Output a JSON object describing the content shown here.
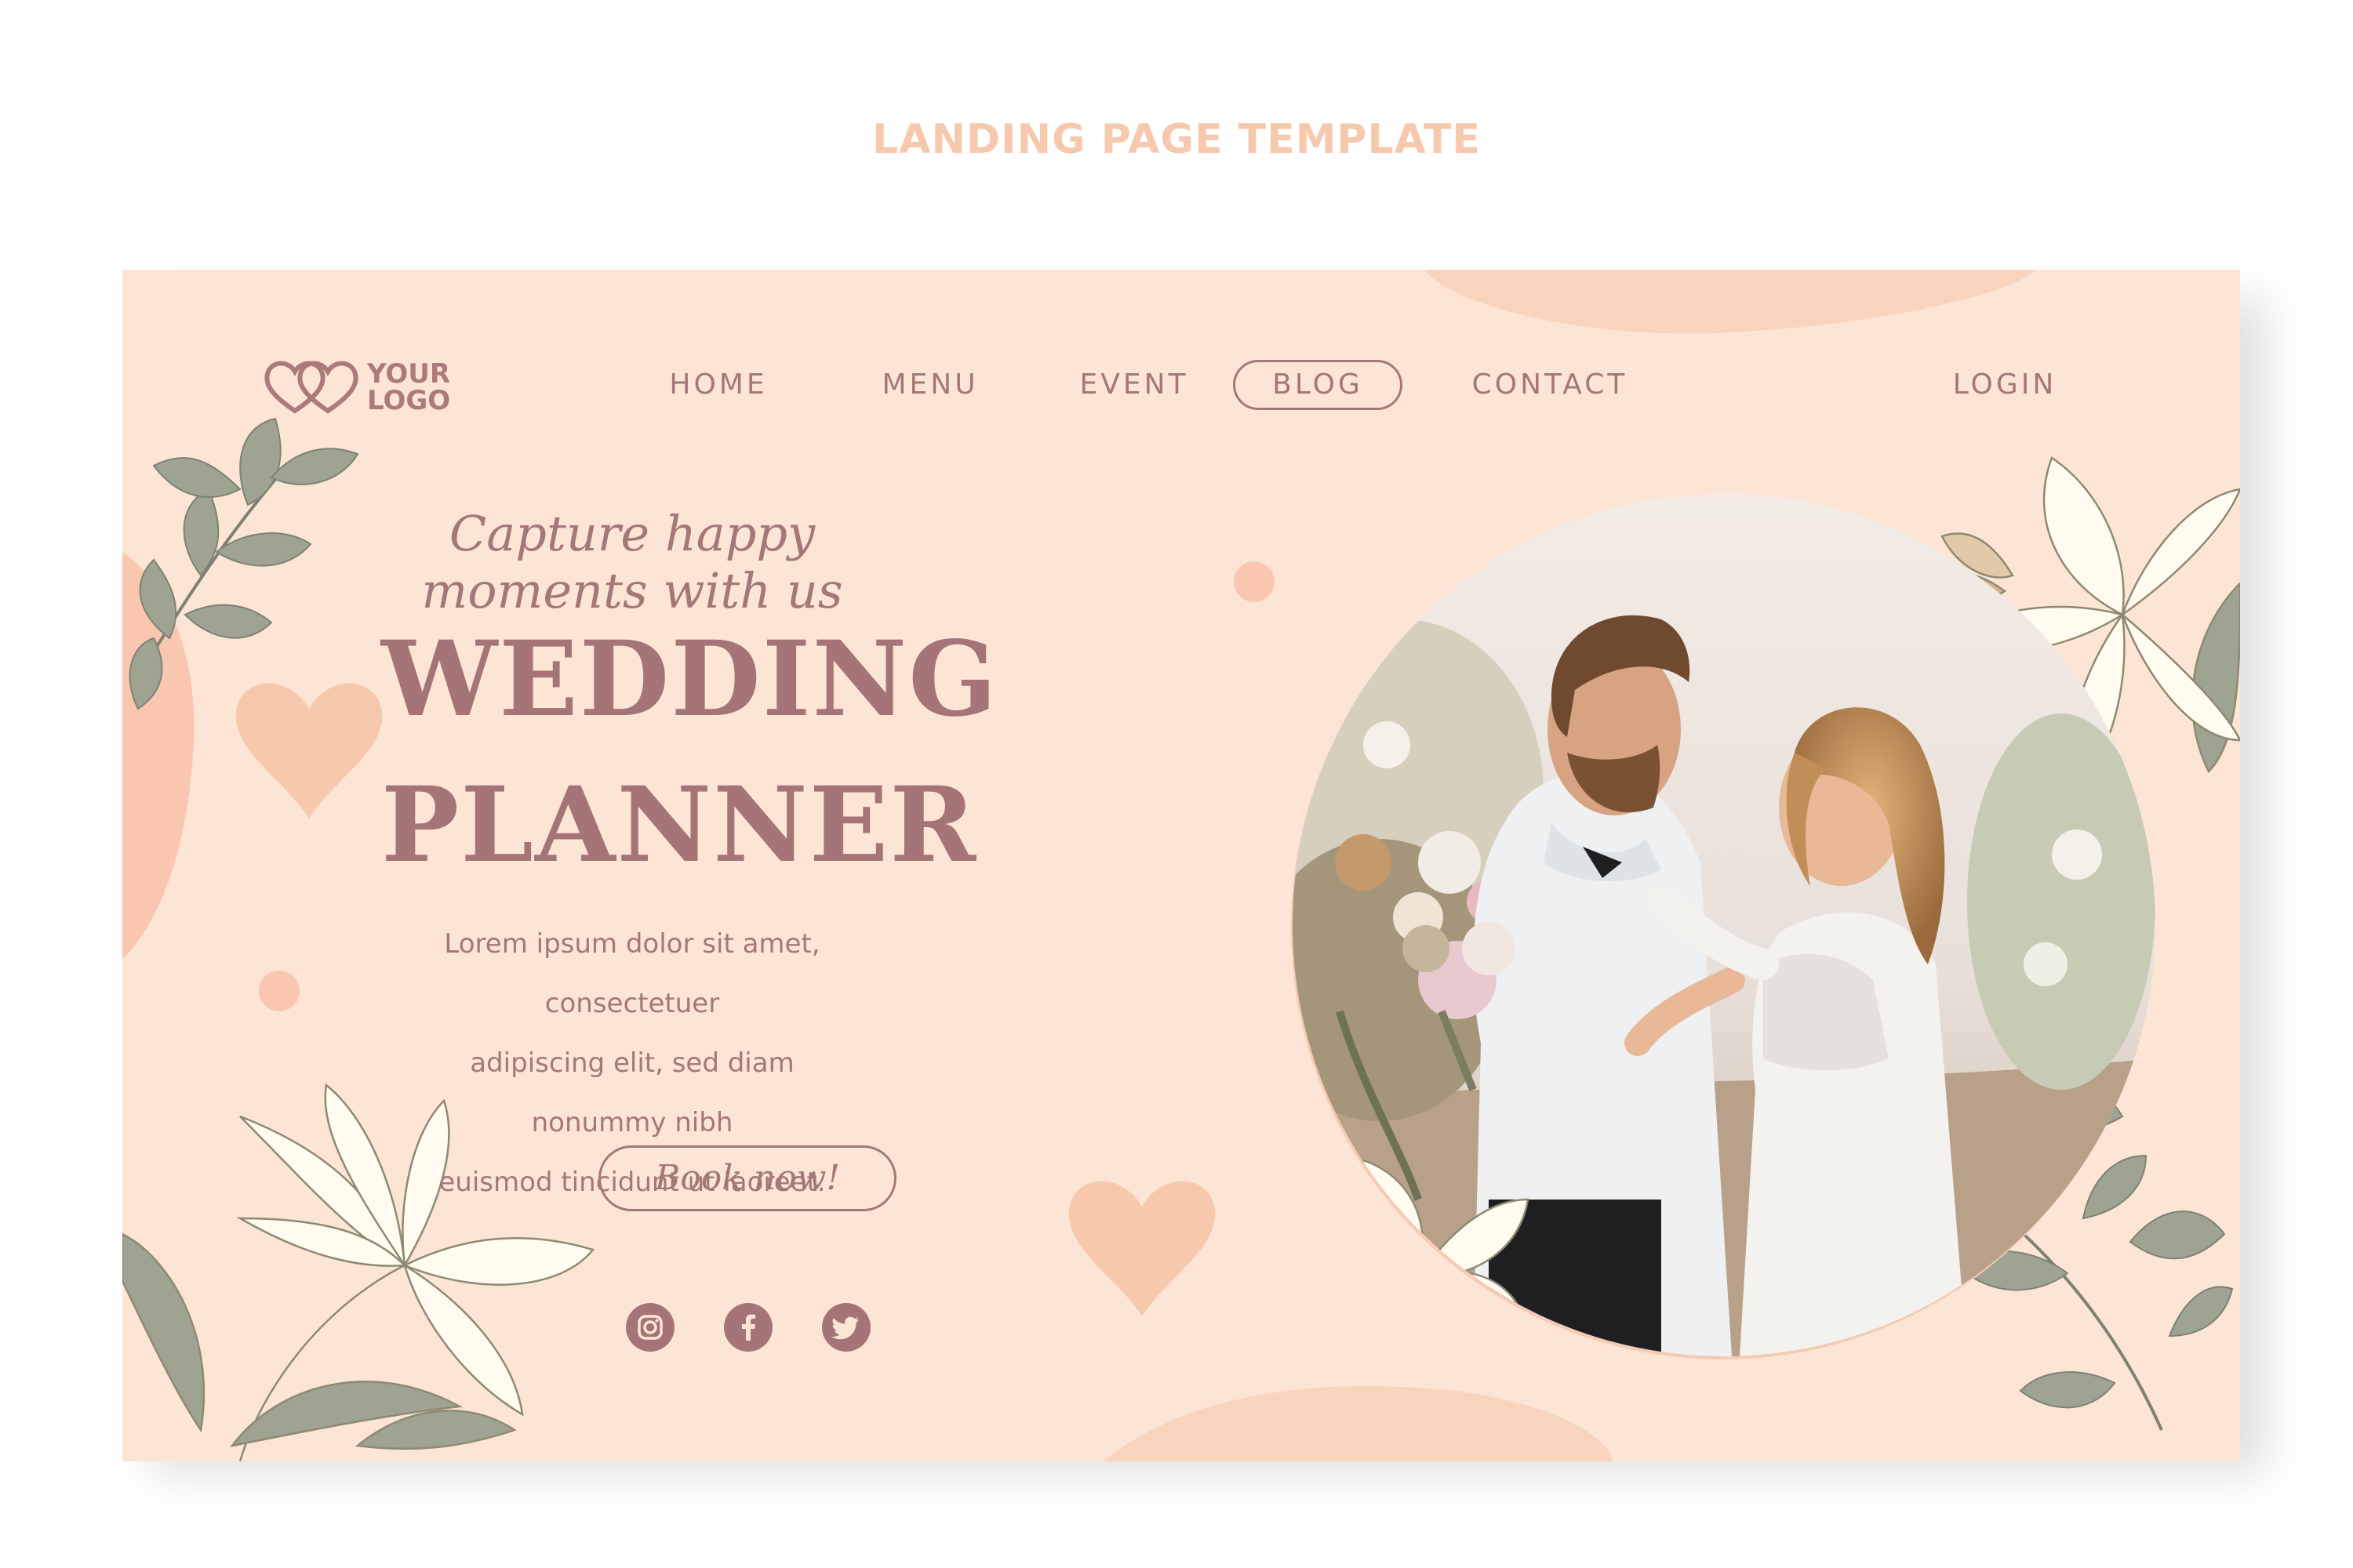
{
  "page_caption": "LANDING PAGE TEMPLATE",
  "logo": {
    "line1": "YOUR",
    "line2": "LOGO",
    "icon": "double-heart-icon"
  },
  "nav": {
    "home": "HOME",
    "menu": "MENU",
    "event": "EVENT",
    "blog": "BLOG",
    "contact": "CONTACT",
    "login": "LOGIN",
    "active": "BLOG"
  },
  "hero": {
    "tagline": "Capture happy moments with us",
    "headline_line1": "WEDDING",
    "headline_line2": "PLANNER",
    "body_line1": "Lorem ipsum dolor sit amet, consectetuer",
    "body_line2": "adipiscing elit, sed diam nonummy nibh",
    "body_line3": "euismod tincidunt ut laoreet.",
    "cta": "Book now!"
  },
  "social": [
    "instagram-icon",
    "facebook-icon",
    "twitter-icon"
  ],
  "colors": {
    "background": "#fde5d6",
    "accent": "#a47476",
    "blob": "#f9cfb8",
    "leaf": "#9ea392",
    "lily": "#fffbee",
    "caption": "#f6c9ad"
  }
}
